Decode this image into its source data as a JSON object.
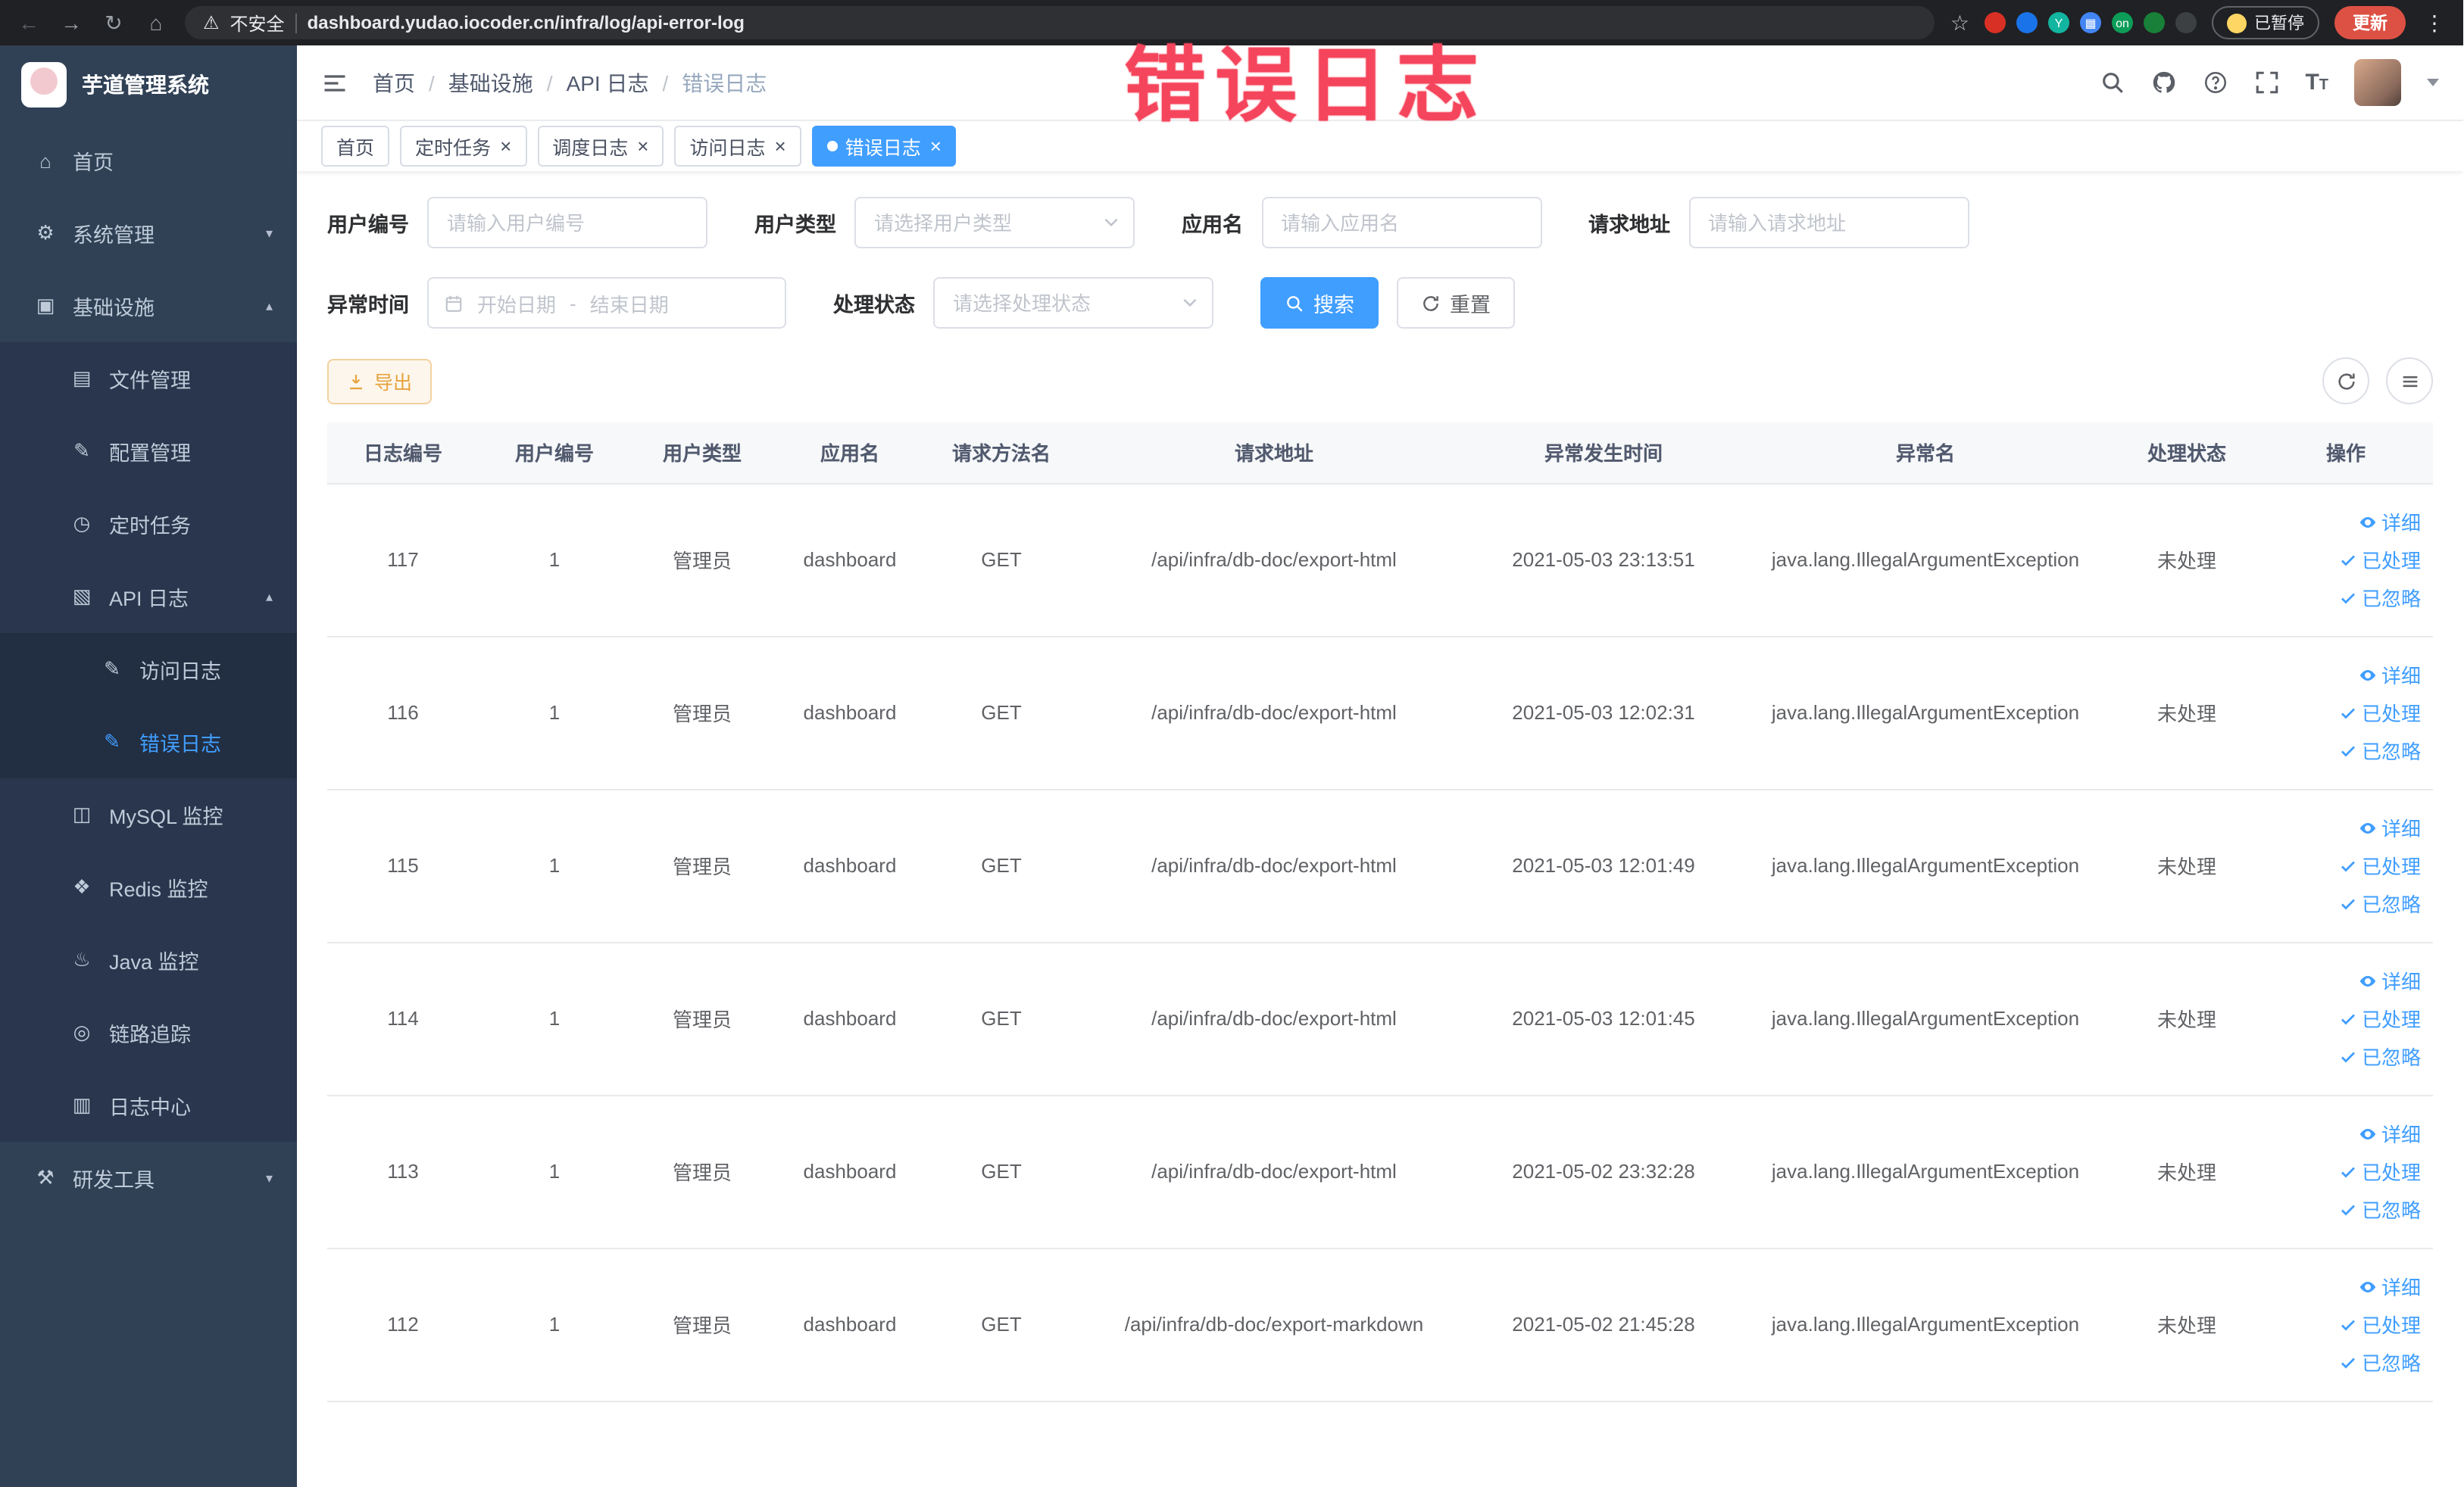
{
  "colors": {
    "accent": "#409eff",
    "warning": "#e6a23c",
    "annotation": "#f5455c",
    "sidebar_bg": "#304156"
  },
  "annotation": {
    "title": "错误日志"
  },
  "browser": {
    "security_label": "不安全",
    "url": "dashboard.yudao.iocoder.cn/infra/log/api-error-log",
    "paused_label": "已暂停",
    "update_label": "更新",
    "extensions": [
      {
        "name": "extension-red-icon",
        "bg": "#d93025",
        "label": ""
      },
      {
        "name": "extension-blue-drop-icon",
        "bg": "#1a73e8",
        "label": ""
      },
      {
        "name": "extension-teal-y-icon",
        "bg": "#12b5a0",
        "label": "Y"
      },
      {
        "name": "extension-grid-icon",
        "bg": "#4285f4",
        "label": "▦"
      },
      {
        "name": "extension-on-badge-icon",
        "bg": "#0c9d58",
        "label": "on"
      },
      {
        "name": "extension-leaf-icon",
        "bg": "#188038",
        "label": ""
      },
      {
        "name": "extension-dark-icon",
        "bg": "#3c4043",
        "label": ""
      }
    ]
  },
  "sidebar": {
    "logo": "芋道管理系统",
    "menu": [
      {
        "label": "首页",
        "icon": "home-icon",
        "glyph": "⌂",
        "level": 1,
        "arrow": "",
        "active": false
      },
      {
        "label": "系统管理",
        "icon": "gear-icon",
        "glyph": "⚙",
        "level": 1,
        "arrow": "down",
        "active": false
      },
      {
        "label": "基础设施",
        "icon": "infrastructure-icon",
        "glyph": "▣",
        "level": 1,
        "arrow": "up",
        "active": false
      },
      {
        "label": "文件管理",
        "icon": "file-manage-icon",
        "glyph": "▤",
        "level": 2,
        "arrow": "",
        "active": false
      },
      {
        "label": "配置管理",
        "icon": "config-manage-icon",
        "glyph": "✎",
        "level": 2,
        "arrow": "",
        "active": false
      },
      {
        "label": "定时任务",
        "icon": "scheduled-job-icon",
        "glyph": "◷",
        "level": 2,
        "arrow": "",
        "active": false
      },
      {
        "label": "API 日志",
        "icon": "api-log-icon",
        "glyph": "▧",
        "level": 2,
        "arrow": "up",
        "active": false
      },
      {
        "label": "访问日志",
        "icon": "access-log-icon",
        "glyph": "✎",
        "level": 3,
        "arrow": "",
        "active": false
      },
      {
        "label": "错误日志",
        "icon": "error-log-icon",
        "glyph": "✎",
        "level": 3,
        "arrow": "",
        "active": true
      },
      {
        "label": "MySQL 监控",
        "icon": "mysql-monitor-icon",
        "glyph": "◫",
        "level": 2,
        "arrow": "",
        "active": false
      },
      {
        "label": "Redis 监控",
        "icon": "redis-monitor-icon",
        "glyph": "❖",
        "level": 2,
        "arrow": "",
        "active": false
      },
      {
        "label": "Java 监控",
        "icon": "java-monitor-icon",
        "glyph": "♨",
        "level": 2,
        "arrow": "",
        "active": false
      },
      {
        "label": "链路追踪",
        "icon": "trace-icon",
        "glyph": "◎",
        "level": 2,
        "arrow": "",
        "active": false
      },
      {
        "label": "日志中心",
        "icon": "log-center-icon",
        "glyph": "▥",
        "level": 2,
        "arrow": "",
        "active": false
      },
      {
        "label": "研发工具",
        "icon": "dev-tool-icon",
        "glyph": "⚒",
        "level": 1,
        "arrow": "down",
        "active": false
      }
    ]
  },
  "header": {
    "breadcrumb": [
      "首页",
      "基础设施",
      "API 日志",
      "错误日志"
    ]
  },
  "tabs": [
    {
      "label": "首页",
      "closable": false,
      "active": false
    },
    {
      "label": "定时任务",
      "closable": true,
      "active": false
    },
    {
      "label": "调度日志",
      "closable": true,
      "active": false
    },
    {
      "label": "访问日志",
      "closable": true,
      "active": false
    },
    {
      "label": "错误日志",
      "closable": true,
      "active": true
    }
  ],
  "filters": {
    "user_id": {
      "label": "用户编号",
      "placeholder": "请输入用户编号"
    },
    "user_type": {
      "label": "用户类型",
      "placeholder": "请选择用户类型"
    },
    "app_name": {
      "label": "应用名",
      "placeholder": "请输入应用名"
    },
    "request_url": {
      "label": "请求地址",
      "placeholder": "请输入请求地址"
    },
    "exception_time": {
      "label": "异常时间",
      "start_placeholder": "开始日期",
      "separator": "-",
      "end_placeholder": "结束日期"
    },
    "process_status": {
      "label": "处理状态",
      "placeholder": "请选择处理状态"
    },
    "search_label": "搜索",
    "reset_label": "重置"
  },
  "toolbar": {
    "export_label": "导出"
  },
  "table": {
    "headers": [
      "日志编号",
      "用户编号",
      "用户类型",
      "应用名",
      "请求方法名",
      "请求地址",
      "异常发生时间",
      "异常名",
      "处理状态",
      "操作"
    ],
    "row_actions": [
      "详细",
      "已处理",
      "已忽略"
    ],
    "rows": [
      {
        "id": "117",
        "user_id": "1",
        "user_type": "管理员",
        "app": "dashboard",
        "method": "GET",
        "url": "/api/infra/db-doc/export-html",
        "time": "2021-05-03 23:13:51",
        "exception": "java.lang.IllegalArgumentException",
        "status": "未处理"
      },
      {
        "id": "116",
        "user_id": "1",
        "user_type": "管理员",
        "app": "dashboard",
        "method": "GET",
        "url": "/api/infra/db-doc/export-html",
        "time": "2021-05-03 12:02:31",
        "exception": "java.lang.IllegalArgumentException",
        "status": "未处理"
      },
      {
        "id": "115",
        "user_id": "1",
        "user_type": "管理员",
        "app": "dashboard",
        "method": "GET",
        "url": "/api/infra/db-doc/export-html",
        "time": "2021-05-03 12:01:49",
        "exception": "java.lang.IllegalArgumentException",
        "status": "未处理"
      },
      {
        "id": "114",
        "user_id": "1",
        "user_type": "管理员",
        "app": "dashboard",
        "method": "GET",
        "url": "/api/infra/db-doc/export-html",
        "time": "2021-05-03 12:01:45",
        "exception": "java.lang.IllegalArgumentException",
        "status": "未处理"
      },
      {
        "id": "113",
        "user_id": "1",
        "user_type": "管理员",
        "app": "dashboard",
        "method": "GET",
        "url": "/api/infra/db-doc/export-html",
        "time": "2021-05-02 23:32:28",
        "exception": "java.lang.IllegalArgumentException",
        "status": "未处理"
      },
      {
        "id": "112",
        "user_id": "1",
        "user_type": "管理员",
        "app": "dashboard",
        "method": "GET",
        "url": "/api/infra/db-doc/export-markdown",
        "time": "2021-05-02 21:45:28",
        "exception": "java.lang.IllegalArgumentException",
        "status": "未处理"
      }
    ]
  }
}
